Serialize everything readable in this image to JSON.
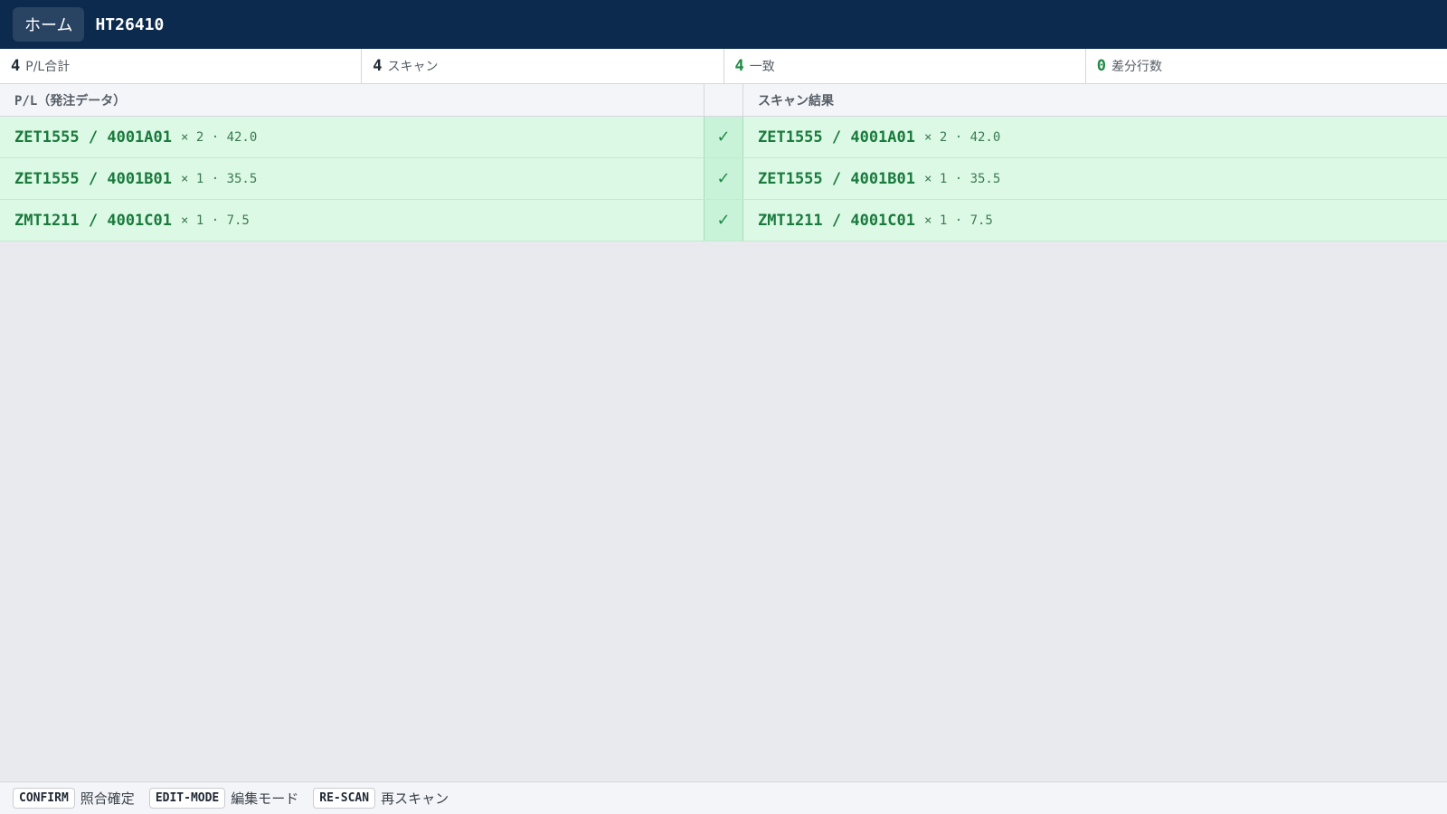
{
  "header": {
    "home_label": "ホーム",
    "doc_id": "HT26410"
  },
  "stats": [
    {
      "value": "4",
      "label": "P/L合計",
      "color": "#1f2933"
    },
    {
      "value": "4",
      "label": "スキャン",
      "color": "#1f2933"
    },
    {
      "value": "4",
      "label": "一致",
      "color": "#1f8a45"
    },
    {
      "value": "0",
      "label": "差分行数",
      "color": "#1f8a45"
    }
  ],
  "grid": {
    "left_header": "P/L（発注データ）",
    "right_header": "スキャン結果",
    "match_icon": "check-icon",
    "match_symbol": "✓",
    "rows": [
      {
        "pl": {
          "code": "ZET1555 / 4001A01",
          "meta": "× 2 · 42.0"
        },
        "scan": {
          "code": "ZET1555 / 4001A01",
          "meta": "× 2 · 42.0"
        }
      },
      {
        "pl": {
          "code": "ZET1555 / 4001B01",
          "meta": "× 1 · 35.5"
        },
        "scan": {
          "code": "ZET1555 / 4001B01",
          "meta": "× 1 · 35.5"
        }
      },
      {
        "pl": {
          "code": "ZMT1211 / 4001C01",
          "meta": "× 1 · 7.5"
        },
        "scan": {
          "code": "ZMT1211 / 4001C01",
          "meta": "× 1 · 7.5"
        }
      }
    ]
  },
  "footer": {
    "shortcuts": [
      {
        "key": "CONFIRM",
        "label": "照合確定"
      },
      {
        "key": "EDIT-MODE",
        "label": "編集モード"
      },
      {
        "key": "RE-SCAN",
        "label": "再スキャン"
      }
    ]
  },
  "colors": {
    "topbar": "#0c2a4d",
    "match_row": "#dcf9e6",
    "match_text": "#1a7a3c"
  }
}
